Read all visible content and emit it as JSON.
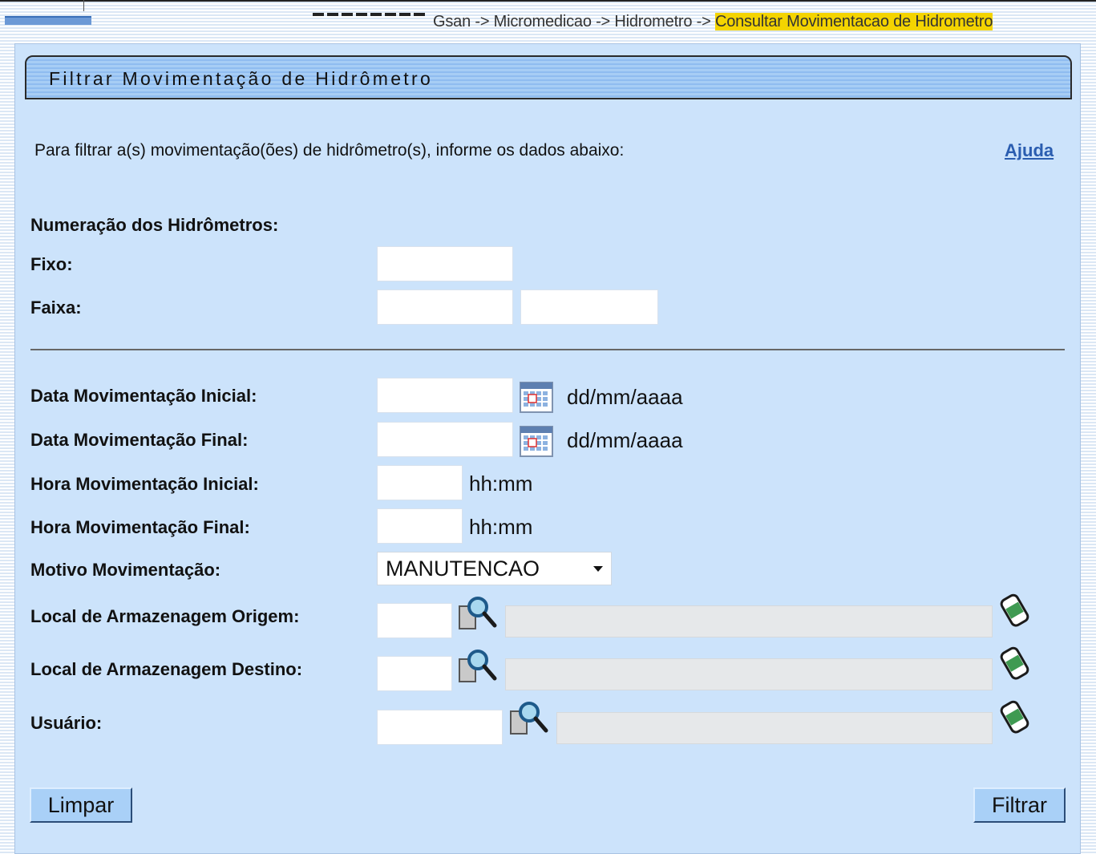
{
  "breadcrumb": {
    "prefix": "Gsan -> Micromedicao -> Hidrometro -> ",
    "current": "Consultar Movimentacao de Hidrometro"
  },
  "panel": {
    "title": "Filtrar Movimentação de Hidrômetro",
    "intro": "Para filtrar a(s) movimentação(ões) de hidrômetro(s), informe os dados abaixo:",
    "help_link": "Ajuda"
  },
  "form": {
    "numeracao_label": "Numeração dos Hidrômetros:",
    "fixo_label": "Fixo:",
    "faixa_label": "Faixa:",
    "data_inicial_label": "Data Movimentação Inicial:",
    "data_final_label": "Data Movimentação Final:",
    "hora_inicial_label": "Hora Movimentação Inicial:",
    "hora_final_label": "Hora Movimentação Final:",
    "motivo_label": "Motivo Movimentação:",
    "motivo_value": "MANUTENCAO",
    "local_origem_label": "Local de Armazenagem Origem:",
    "local_destino_label": "Local de Armazenagem Destino:",
    "usuario_label": "Usuário:",
    "date_format_hint": "dd/mm/aaaa",
    "time_format_hint": "hh:mm"
  },
  "buttons": {
    "clear": "Limpar",
    "filter": "Filtrar"
  },
  "colors": {
    "panel_bg": "#cce3fb",
    "title_bar": "#a7cdf5",
    "breadcrumb_highlight": "#f4d400",
    "link": "#2a5db0"
  },
  "icons": {
    "calendar": "calendar-icon",
    "lookup": "magnifier-lookup-icon",
    "clear": "eraser-icon"
  }
}
